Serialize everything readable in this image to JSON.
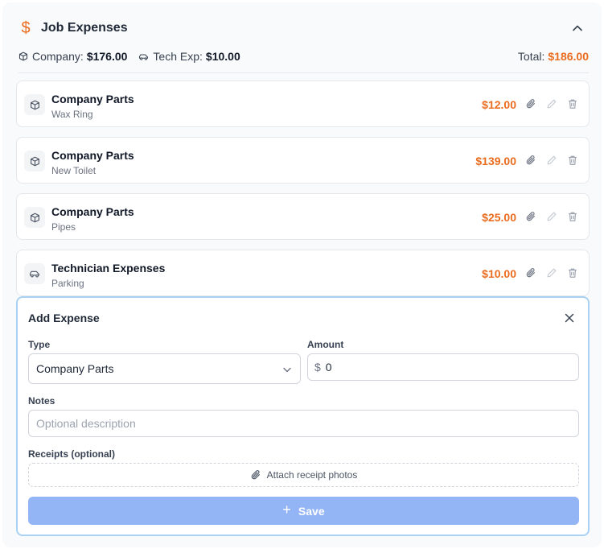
{
  "header": {
    "icon": "dollar-icon",
    "dollar_glyph": "$",
    "title": "Job Expenses",
    "collapse_icon": "chevron-up-icon"
  },
  "summary": {
    "company_label": "Company:",
    "company_value": "$176.00",
    "tech_label": "Tech Exp:",
    "tech_value": "$10.00",
    "total_label": "Total:",
    "total_value": "$186.00"
  },
  "items": [
    {
      "icon": "package-icon",
      "name": "Company Parts",
      "desc": "Wax Ring",
      "price": "$12.00"
    },
    {
      "icon": "package-icon",
      "name": "Company Parts",
      "desc": "New Toilet",
      "price": "$139.00"
    },
    {
      "icon": "package-icon",
      "name": "Company Parts",
      "desc": "Pipes",
      "price": "$25.00"
    },
    {
      "icon": "car-icon",
      "name": "Technician Expenses",
      "desc": "Parking",
      "price": "$10.00"
    }
  ],
  "form": {
    "title": "Add Expense",
    "type_label": "Type",
    "type_value": "Company Parts",
    "amount_label": "Amount",
    "currency": "$",
    "amount_value": "0",
    "notes_label": "Notes",
    "notes_placeholder": "Optional description",
    "receipts_label": "Receipts (optional)",
    "attach_label": "Attach receipt photos",
    "save_label": "Save",
    "save_plus": "+"
  },
  "colors": {
    "accent": "#ea6c1e",
    "save_button": "#93b4f5",
    "form_border": "#a9d1f3"
  }
}
